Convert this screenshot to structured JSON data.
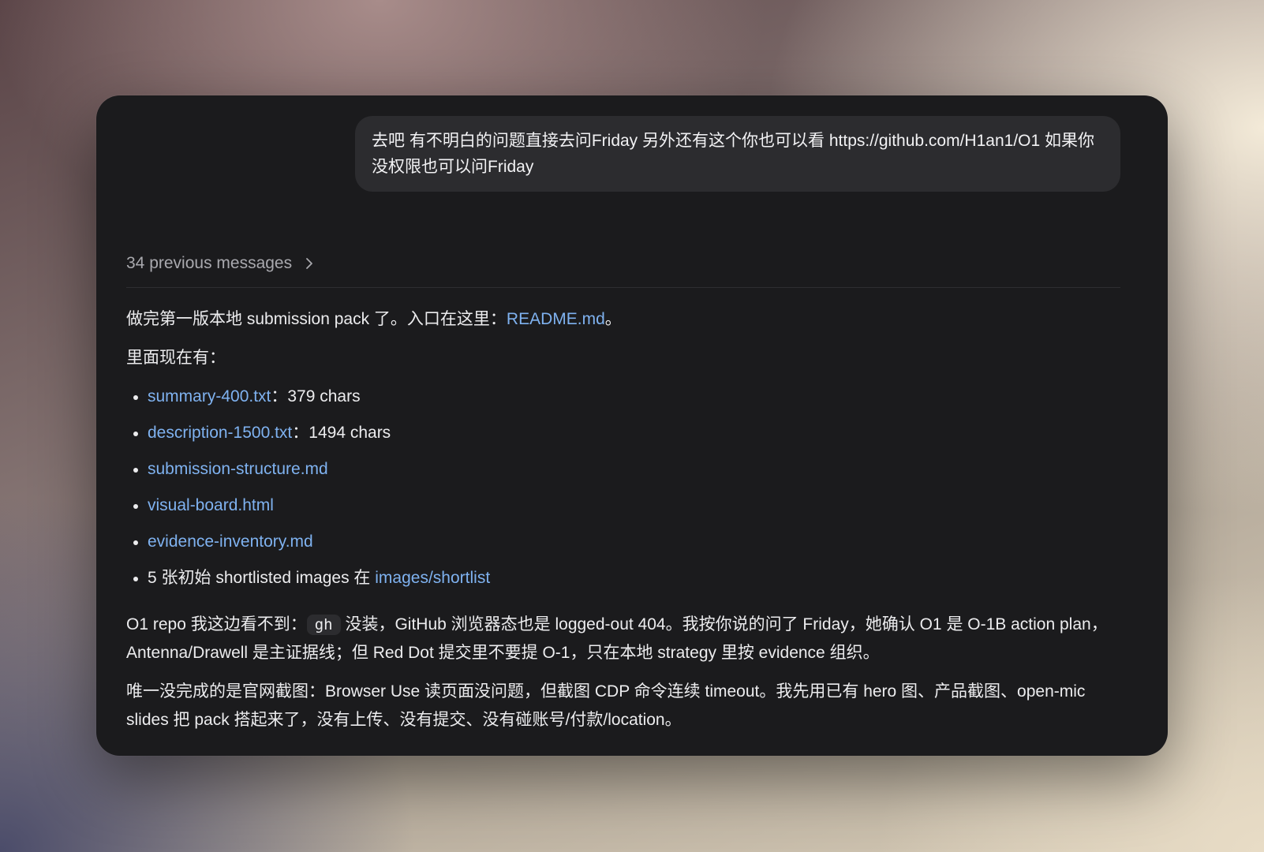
{
  "user_message": {
    "text": "去吧 有不明白的问题直接去问Friday 另外还有这个你也可以看 https://github.com/H1an1/O1 如果你没权限也可以问Friday"
  },
  "previous_messages": {
    "label": "34 previous messages",
    "icon": "chevron-right-icon"
  },
  "assistant": {
    "intro_before": "做完第一版本地 submission pack 了。入口在这里：",
    "intro_link": "README.md",
    "intro_after": "。",
    "contents_heading": "里面现在有：",
    "files": [
      {
        "link": "summary-400.txt",
        "suffix": "：379 chars"
      },
      {
        "link": "description-1500.txt",
        "suffix": "：1494 chars"
      },
      {
        "link": "submission-structure.md",
        "suffix": ""
      },
      {
        "link": "visual-board.html",
        "suffix": ""
      },
      {
        "link": "evidence-inventory.md",
        "suffix": ""
      },
      {
        "prefix": "5 张初始 shortlisted images 在 ",
        "link": "images/shortlist"
      }
    ],
    "repo_before": "O1 repo 我这边看不到：",
    "repo_code": "gh",
    "repo_after": " 没装，GitHub 浏览器态也是 logged-out 404。我按你说的问了 Friday，她确认 O1 是 O-1B action plan，Antenna/Drawell 是主证据线；但 Red Dot 提交里不要提 O-1，只在本地 strategy 里按 evidence 组织。",
    "final": "唯一没完成的是官网截图：Browser Use 读页面没问题，但截图 CDP 命令连续 timeout。我先用已有 hero 图、产品截图、open-mic slides 把 pack 搭起来了，没有上传、没有提交、没有碰账号/付款/location。"
  },
  "colors": {
    "window_bg": "#1b1b1d",
    "bubble_bg": "#2c2c2f",
    "link": "#7fb2f0",
    "muted_text": "#a9a9ae"
  }
}
